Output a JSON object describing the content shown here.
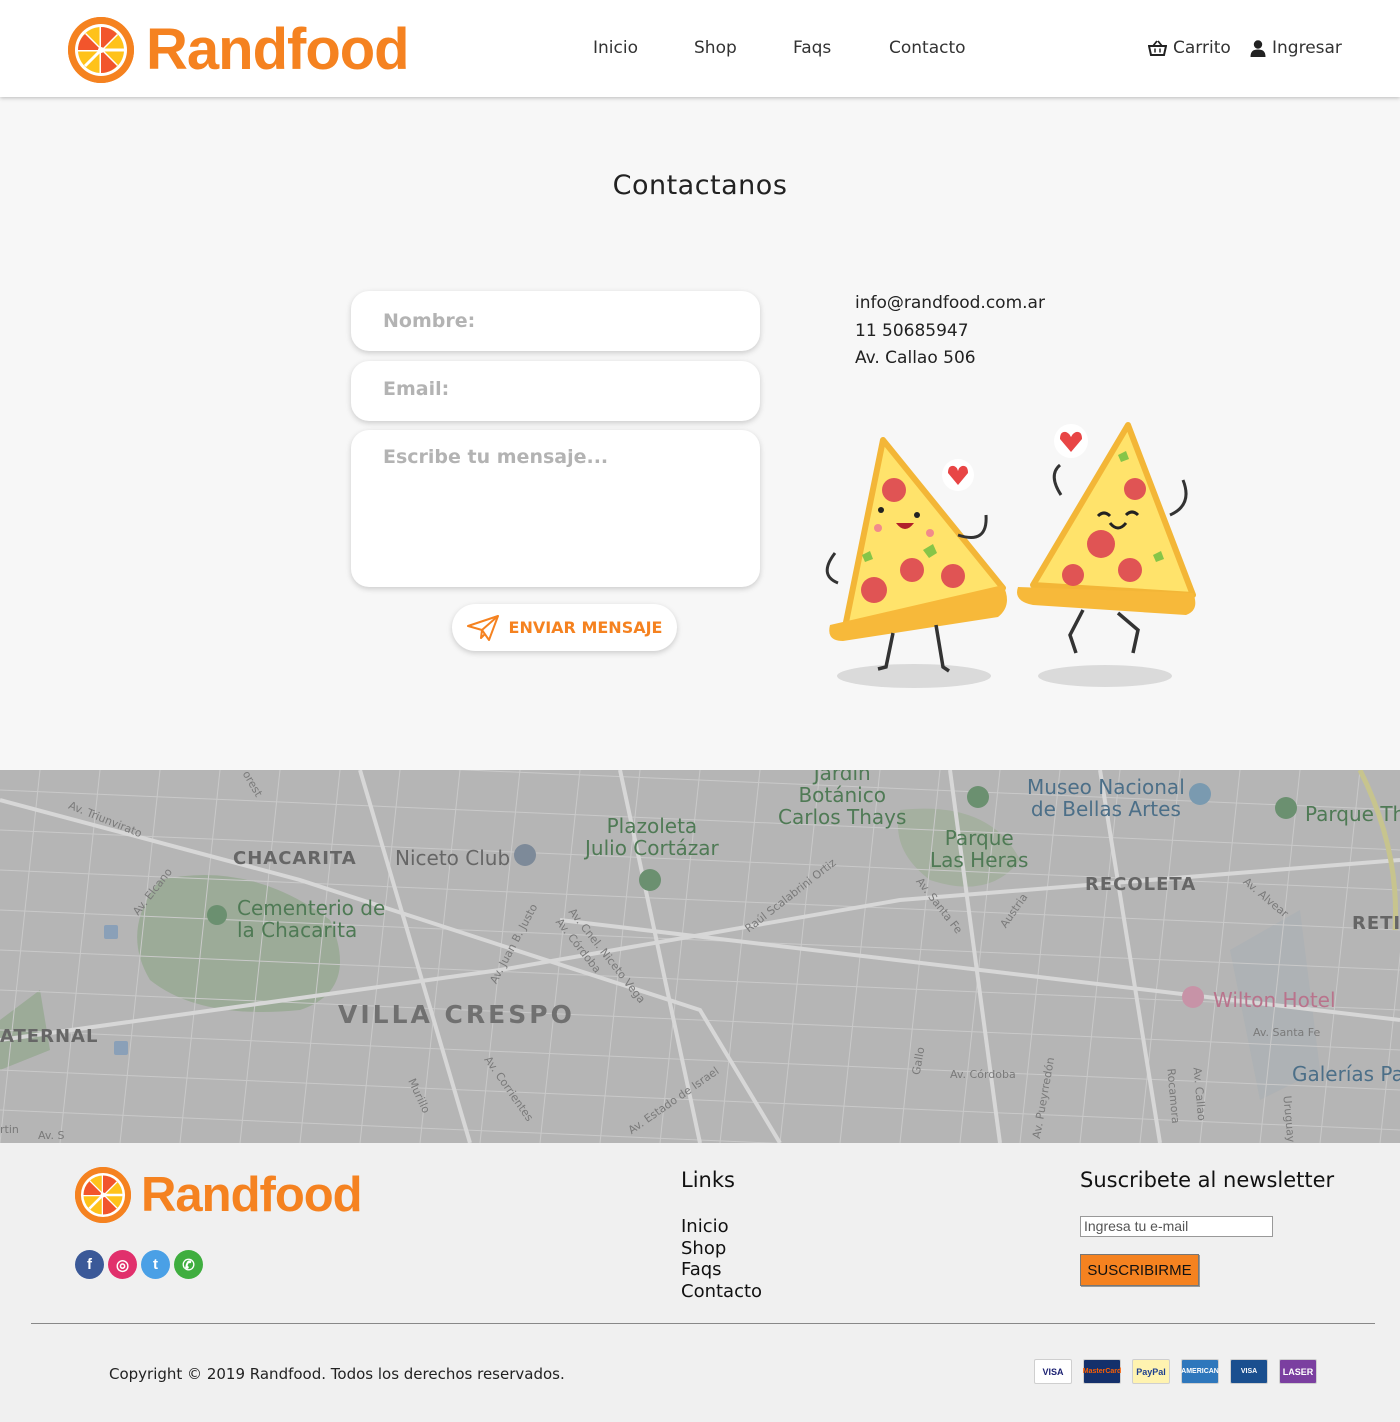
{
  "header": {
    "brand": "Randfood",
    "nav": [
      {
        "label": "Inicio"
      },
      {
        "label": "Shop"
      },
      {
        "label": "Faqs"
      },
      {
        "label": "Contacto"
      }
    ],
    "cart_label": "Carrito",
    "login_label": "Ingresar"
  },
  "contact": {
    "title": "Contactanos",
    "name_placeholder": "Nombre:",
    "email_placeholder": "Email:",
    "message_placeholder": "Escribe tu mensaje...",
    "send_label": "ENVIAR MENSAJE",
    "email": "info@randfood.com.ar",
    "phone": "11 50685947",
    "address": "Av. Callao 506"
  },
  "map": {
    "labels": {
      "jardin": "Jardín\nBotánico\nCarlos Thays",
      "museo": "Museo Nacional\nde Bellas Artes",
      "parque_th": "Parque Th",
      "plazoleta": "Plazoleta\nJulio Cortázar",
      "parque_heras": "Parque\nLas Heras",
      "chacarita": "CHACARITA",
      "niceto": "Niceto Club",
      "recoleta": "RECOLETA",
      "retiro": "RETI",
      "cementerio": "Cementerio de\nla Chacarita",
      "villa_crespo": "VILLA CRESPO",
      "paternal": "ATERNAL",
      "wilton": "Wilton Hotel",
      "galerias": "Galerías Pa",
      "av_triunvirato": "Av. Triunvirato",
      "av_elcano": "Av. Elcano",
      "av_juan_b_justo": "Av. Juan B. Justo",
      "av_niceto_vega": "Av. Cnel. Niceto Vega",
      "av_cordoba_1": "Av. Córdoba",
      "scalabrini": "Raúl Scalabrini Ortiz",
      "av_santa_fe_1": "Av. Santa Fe",
      "austria": "Austria",
      "av_alvear": "Av. Alvear",
      "av_santa_fe_2": "Av. Santa Fe",
      "av_corrientes": "Av. Corrientes",
      "av_estado_israel": "Av. Estado de Israel",
      "gallo": "Gallo",
      "av_cordoba_2": "Av. Córdoba",
      "av_pueyrredon": "Av. Pueyrredón",
      "rocamora": "Rocamora",
      "av_callao": "Av. Callao",
      "uruguay": "Uruguay",
      "murillo": "Murillo",
      "forest": "orest",
      "artin": "rtin",
      "av_s": "Av. S"
    }
  },
  "footer": {
    "brand": "Randfood",
    "social": [
      {
        "icon": "facebook-icon",
        "glyph": "f",
        "color": "#3b5998"
      },
      {
        "icon": "instagram-icon",
        "glyph": "◎",
        "color": "#e1306c"
      },
      {
        "icon": "twitter-icon",
        "glyph": "t",
        "color": "#4aa0e6"
      },
      {
        "icon": "whatsapp-icon",
        "glyph": "✆",
        "color": "#3fae3f"
      }
    ],
    "links_title": "Links",
    "links": [
      {
        "label": "Inicio"
      },
      {
        "label": "Shop"
      },
      {
        "label": "Faqs"
      },
      {
        "label": "Contacto"
      }
    ],
    "newsletter_title": "Suscribete al newsletter",
    "newsletter_placeholder": "Ingresa tu e-mail",
    "subscribe_label": "SUSCRIBIRME",
    "copyright": "Copyright © 2019 Randfood. Todos los derechos reservados.",
    "payment_cards": [
      {
        "label": "VISA",
        "bg": "#ffffff",
        "fg": "#1a1f71"
      },
      {
        "label": "MasterCard",
        "bg": "#14306b",
        "fg": "#ff5f00"
      },
      {
        "label": "PayPal",
        "bg": "#fff3b0",
        "fg": "#1d3f8f"
      },
      {
        "label": "AMERICAN EXPRESS",
        "bg": "#2e77bc",
        "fg": "#ffffff"
      },
      {
        "label": "VISA Electron",
        "bg": "#1a4f8f",
        "fg": "#ffffff"
      },
      {
        "label": "LASER",
        "bg": "#7b3fa0",
        "fg": "#ffffff"
      }
    ]
  },
  "colors": {
    "brand_orange": "#f58220",
    "page_bg": "#f7f7f7",
    "footer_bg": "#f0f0f0"
  }
}
